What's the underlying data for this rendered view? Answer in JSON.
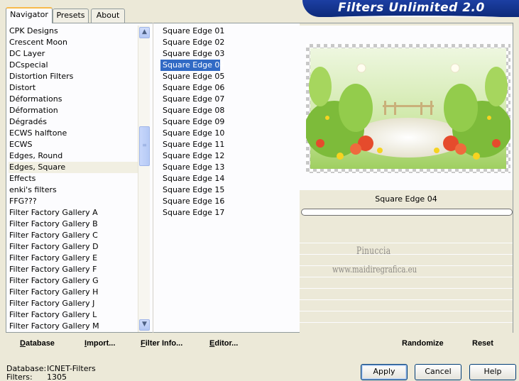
{
  "window": {
    "title": "Filters Unlimited 2.0"
  },
  "tabs": [
    {
      "label": "Navigator",
      "active": true
    },
    {
      "label": "Presets",
      "active": false
    },
    {
      "label": "About",
      "active": false
    }
  ],
  "categories": {
    "items": [
      "CPK Designs",
      "Crescent Moon",
      "DC Layer",
      "DCspecial",
      "Distortion Filters",
      "Distort",
      "Déformations",
      "Déformation",
      "Dégradés",
      "ECWS halftone",
      "ECWS",
      "Edges, Round",
      "Edges, Square",
      "Effects",
      "enki's filters",
      "FFG???",
      "Filter Factory Gallery A",
      "Filter Factory Gallery B",
      "Filter Factory Gallery C",
      "Filter Factory Gallery D",
      "Filter Factory Gallery E",
      "Filter Factory Gallery F",
      "Filter Factory Gallery G",
      "Filter Factory Gallery H",
      "Filter Factory Gallery J",
      "Filter Factory Gallery L",
      "Filter Factory Gallery M"
    ],
    "selected": "Edges, Square",
    "scroll": {
      "up_icon": "▲",
      "down_icon": "▼",
      "thumb_grip": "≡"
    }
  },
  "filters": {
    "items": [
      "Square Edge 01",
      "Square Edge 02",
      "Square Edge 03",
      "Square Edge 04",
      "Square Edge 05",
      "Square Edge 06",
      "Square Edge 07",
      "Square Edge 08",
      "Square Edge 09",
      "Square Edge 10",
      "Square Edge 11",
      "Square Edge 12",
      "Square Edge 13",
      "Square Edge 14",
      "Square Edge 15",
      "Square Edge 16",
      "Square Edge 17"
    ],
    "selected": "Square Edge 04"
  },
  "preview": {
    "filter_name": "Square Edge 04",
    "watermark_line1": "Pinuccia",
    "watermark_line2": "www.maidiregrafica.eu"
  },
  "actions": {
    "database": {
      "underlined": "D",
      "rest": "atabase"
    },
    "import": {
      "underlined": "I",
      "rest": "mport..."
    },
    "filter_info": {
      "underlined": "F",
      "rest": "ilter Info..."
    },
    "editor": {
      "underlined": "E",
      "rest": "ditor..."
    },
    "randomize": "Randomize",
    "reset": "Reset"
  },
  "info": {
    "database_label": "Database:",
    "database_value": "ICNET-Filters",
    "filters_label": "Filters:",
    "filters_value": "1305"
  },
  "buttons": {
    "apply": "Apply",
    "cancel": "Cancel",
    "help": "Help"
  },
  "colors": {
    "selection": "#316ac5",
    "banner": "#0d2a7a",
    "face": "#ece9d8"
  }
}
